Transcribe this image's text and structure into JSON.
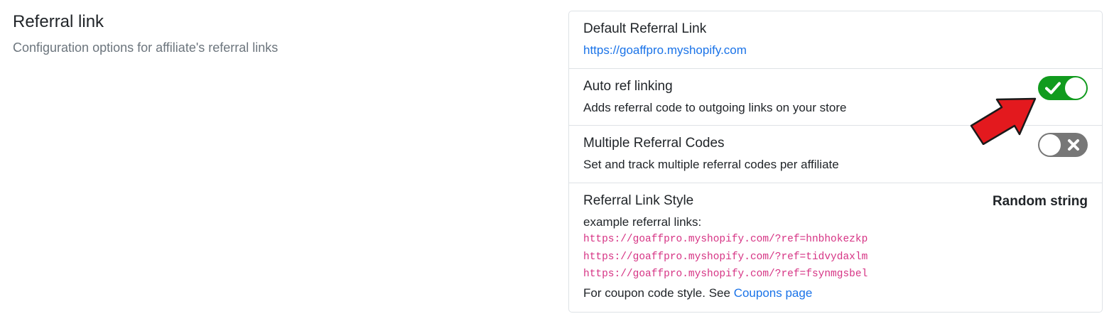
{
  "section": {
    "title": "Referral link",
    "subtitle": "Configuration options for affiliate's referral links"
  },
  "default_link": {
    "title": "Default Referral Link",
    "url": "https://goaffpro.myshopify.com"
  },
  "auto_ref": {
    "title": "Auto ref linking",
    "description": "Adds referral code to outgoing links on your store",
    "enabled": true
  },
  "multiple_codes": {
    "title": "Multiple Referral Codes",
    "description": "Set and track multiple referral codes per affiliate",
    "enabled": false
  },
  "link_style": {
    "title": "Referral Link Style",
    "value": "Random string",
    "example_label": "example referral links:",
    "examples": [
      "https://goaffpro.myshopify.com/?ref=hnbhokezkp",
      "https://goaffpro.myshopify.com/?ref=tidvydaxlm",
      "https://goaffpro.myshopify.com/?ref=fsynmgsbel"
    ],
    "coupon_note": "For coupon code style. See",
    "coupon_link": "Coupons page"
  },
  "icons": {
    "toggle_on": "check-icon",
    "toggle_off": "x-icon",
    "annotation": "red-arrow-icon"
  },
  "colors": {
    "toggle_on": "#119b1e",
    "toggle_off": "#777777",
    "link": "#1a73e8",
    "code": "#d63384",
    "arrow": "#e3191e"
  }
}
